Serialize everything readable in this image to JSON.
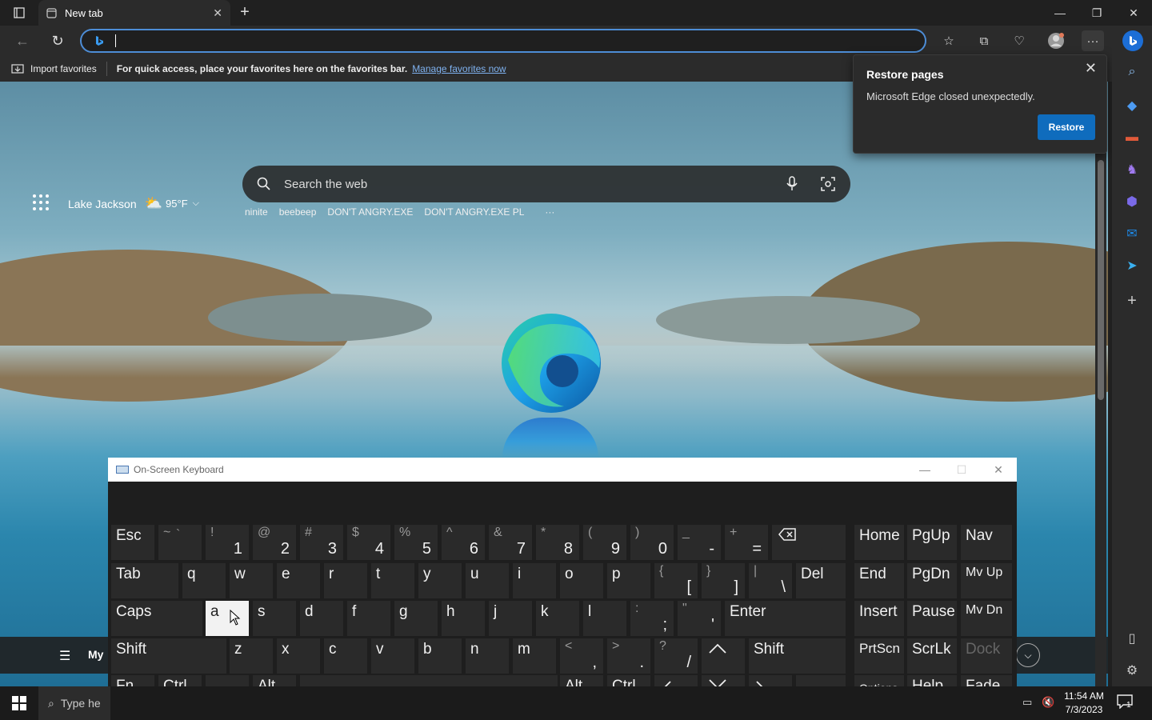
{
  "browser": {
    "tab_title": "New tab",
    "address_value": "",
    "favorites_bar": {
      "import_label": "Import favorites",
      "tip": "For quick access, place your favorites here on the favorites bar.",
      "link": "Manage favorites now"
    }
  },
  "newtab_page": {
    "location": "Lake Jackson",
    "temperature": "95°F",
    "search_placeholder": "Search the web",
    "suggestions": [
      "ninite",
      "beebeep",
      "DON'T ANGRY.EXE",
      "DON'T ANGRY.EXE PL",
      "···"
    ],
    "feed_label": "My"
  },
  "restore_popup": {
    "title": "Restore pages",
    "message": "Microsoft Edge closed unexpectedly.",
    "button": "Restore"
  },
  "osk": {
    "title": "On-Screen Keyboard",
    "keys": {
      "esc": "Esc",
      "tab": "Tab",
      "caps": "Caps",
      "shift": "Shift",
      "fn": "Fn",
      "ctrl": "Ctrl",
      "alt": "Alt",
      "del": "Del",
      "enter": "Enter",
      "home": "Home",
      "pgup": "PgUp",
      "nav": "Nav",
      "end": "End",
      "pgdn": "PgDn",
      "mvup": "Mv Up",
      "insert": "Insert",
      "pause": "Pause",
      "mvdn": "Mv Dn",
      "prtscn": "PrtScn",
      "scrlk": "ScrLk",
      "dock": "Dock",
      "options": "Options",
      "help": "Help",
      "fade": "Fade",
      "q": "q",
      "w": "w",
      "e": "e",
      "r": "r",
      "t": "t",
      "y": "y",
      "u": "u",
      "i": "i",
      "o": "o",
      "p": "p",
      "a": "a",
      "s": "s",
      "d": "d",
      "f": "f",
      "g": "g",
      "h": "h",
      "j": "j",
      "k": "k",
      "l": "l",
      "z": "z",
      "x": "x",
      "c": "c",
      "v": "v",
      "b": "b",
      "n": "n",
      "m": "m"
    },
    "number_row": [
      {
        "top": "~",
        "bottom": "`"
      },
      {
        "top": "!",
        "bottom": "1"
      },
      {
        "top": "@",
        "bottom": "2"
      },
      {
        "top": "#",
        "bottom": "3"
      },
      {
        "top": "$",
        "bottom": "4"
      },
      {
        "top": "%",
        "bottom": "5"
      },
      {
        "top": "^",
        "bottom": "6"
      },
      {
        "top": "&",
        "bottom": "7"
      },
      {
        "top": "*",
        "bottom": "8"
      },
      {
        "top": "(",
        "bottom": "9"
      },
      {
        "top": ")",
        "bottom": "0"
      },
      {
        "top": "_",
        "bottom": "-"
      },
      {
        "top": "+",
        "bottom": "="
      }
    ],
    "punct": {
      "lbrace": "{",
      "lbracket": "[",
      "rbrace": "}",
      "rbracket": "]",
      "pipe": "|",
      "backslash": "\\",
      "colon": ":",
      "semicolon": ";",
      "quote": "\"",
      "apos": "'",
      "lt": "<",
      "comma": ",",
      "gt": ">",
      "period": ".",
      "question": "?",
      "slash": "/"
    }
  },
  "taskbar": {
    "search_placeholder": "Type he",
    "time": "11:54 AM",
    "date": "7/3/2023",
    "notification_count": "1"
  }
}
